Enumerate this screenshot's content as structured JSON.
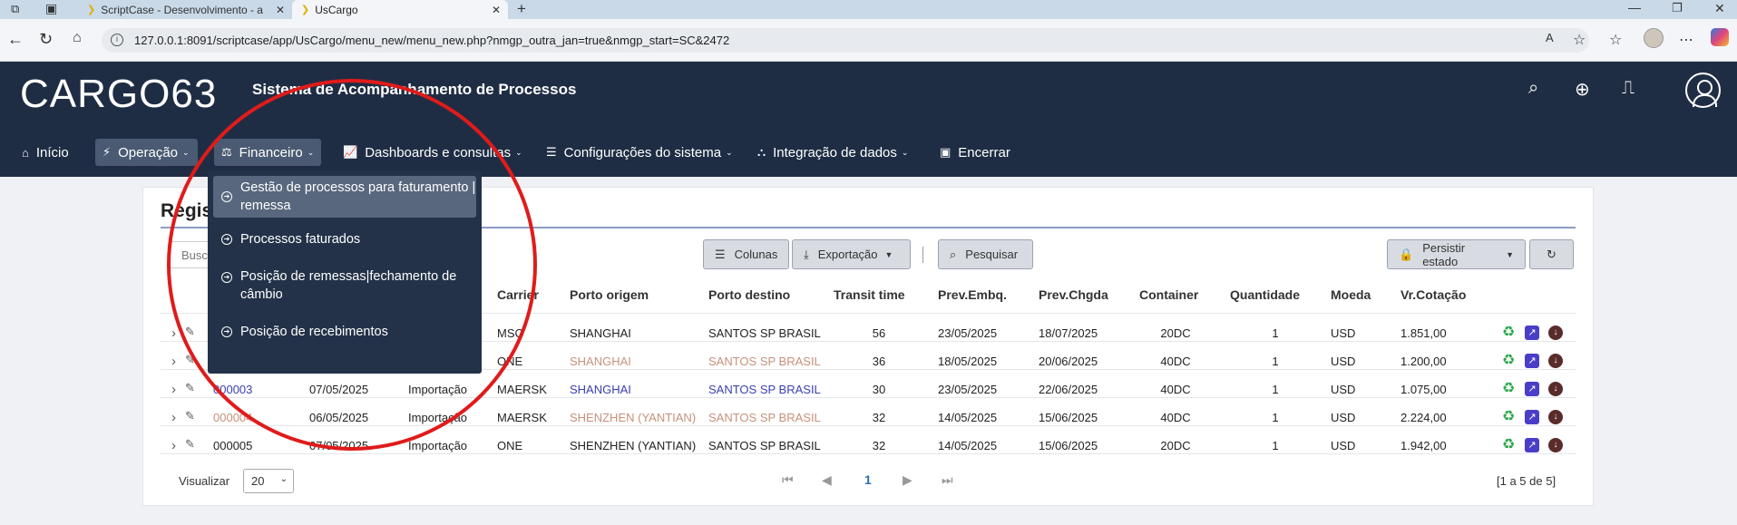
{
  "browser": {
    "tabs": [
      {
        "label": "ScriptCase - Desenvolvimento - a"
      },
      {
        "label": "UsCargo"
      }
    ],
    "url": "127.0.0.1:8091/scriptcase/app/UsCargo/menu_new/menu_new.php?nmgp_outra_jan=true&nmgp_start=SC&2472"
  },
  "app": {
    "logo": "CARGO63",
    "title": "Sistema de Acompanhamento de Processos"
  },
  "menu": {
    "items": [
      {
        "label": "Início"
      },
      {
        "label": "Operação"
      },
      {
        "label": "Financeiro"
      },
      {
        "label": "Dashboards e consultas"
      },
      {
        "label": "Configurações do sistema"
      },
      {
        "label": "Integração de dados"
      },
      {
        "label": "Encerrar"
      }
    ]
  },
  "dropdown": {
    "items": [
      {
        "label": "Gestão de processos para faturamento | remessa"
      },
      {
        "label": "Processos faturados"
      },
      {
        "label": "Posição de remessas|fechamento de câmbio"
      },
      {
        "label": "Posição de recebimentos"
      }
    ]
  },
  "card": {
    "title": "Regis",
    "search_placeholder": "Busc",
    "toolbar": {
      "columns": "Colunas",
      "export": "Exportação",
      "search": "Pesquisar",
      "persist": "Persistir estado"
    }
  },
  "table": {
    "headers": [
      "Carrier",
      "Porto origem",
      "Porto destino",
      "Transit time",
      "Prev.Embq.",
      "Prev.Chgda",
      "Container",
      "Quantidade",
      "Moeda",
      "Vr.Cotação"
    ],
    "rows": [
      {
        "id": "",
        "date": "",
        "type": "",
        "carrier": "MSC",
        "origin": "SHANGHAI",
        "dest": "SANTOS SP BRASIL",
        "transit": "56",
        "embq": "23/05/2025",
        "chgda": "18/07/2025",
        "container": "20DC",
        "qty": "1",
        "currency": "USD",
        "rate": "1.851,00",
        "style": "normal"
      },
      {
        "id": "",
        "date": "",
        "type": "",
        "carrier": "ONE",
        "origin": "SHANGHAI",
        "dest": "SANTOS SP BRASIL",
        "transit": "36",
        "embq": "18/05/2025",
        "chgda": "20/06/2025",
        "container": "40DC",
        "qty": "1",
        "currency": "USD",
        "rate": "1.200,00",
        "style": "tan"
      },
      {
        "id": "000003",
        "date": "07/05/2025",
        "type": "Importação",
        "carrier": "MAERSK",
        "origin": "SHANGHAI",
        "dest": "SANTOS SP BRASIL",
        "transit": "30",
        "embq": "23/05/2025",
        "chgda": "22/06/2025",
        "container": "40DC",
        "qty": "1",
        "currency": "USD",
        "rate": "1.075,00",
        "style": "link"
      },
      {
        "id": "000004",
        "date": "06/05/2025",
        "type": "Importação",
        "carrier": "MAERSK",
        "origin": "SHENZHEN (YANTIAN)",
        "dest": "SANTOS SP BRASIL",
        "transit": "32",
        "embq": "14/05/2025",
        "chgda": "15/06/2025",
        "container": "40DC",
        "qty": "1",
        "currency": "USD",
        "rate": "2.224,00",
        "style": "tan"
      },
      {
        "id": "000005",
        "date": "07/05/2025",
        "type": "Importação",
        "carrier": "ONE",
        "origin": "SHENZHEN (YANTIAN)",
        "dest": "SANTOS SP BRASIL",
        "transit": "32",
        "embq": "14/05/2025",
        "chgda": "15/06/2025",
        "container": "20DC",
        "qty": "1",
        "currency": "USD",
        "rate": "1.942,00",
        "style": "normal"
      }
    ]
  },
  "footer": {
    "visualizar": "Visualizar",
    "page_size": "20",
    "current_page": "1",
    "range": "[1 a 5 de 5]"
  }
}
